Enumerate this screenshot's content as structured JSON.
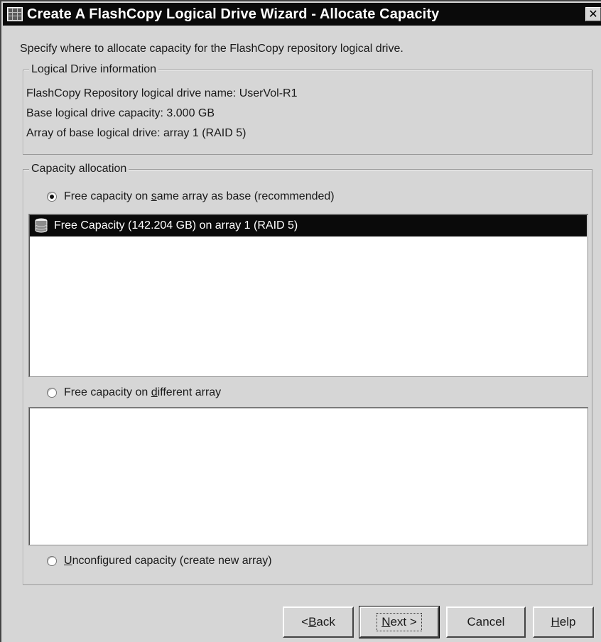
{
  "window": {
    "title": "Create A FlashCopy Logical Drive Wizard - Allocate Capacity",
    "close_glyph": "✕"
  },
  "instruction": "Specify where to allocate capacity for the FlashCopy repository logical drive.",
  "logical_drive_info": {
    "legend": "Logical Drive information",
    "repository_name_line": "FlashCopy Repository logical drive name: UserVol-R1",
    "base_capacity_line": "Base logical drive capacity: 3.000 GB",
    "array_line": "Array of base logical drive: array 1 (RAID 5)"
  },
  "capacity_allocation": {
    "legend": "Capacity allocation",
    "options": [
      {
        "pre": "Free capacity on ",
        "key": "s",
        "post": "ame array as base (recommended)",
        "checked": true
      },
      {
        "pre": "Free capacity on ",
        "key": "d",
        "post": "ifferent array",
        "checked": false
      },
      {
        "pre": "",
        "key": "U",
        "post": "nconfigured capacity (create new array)",
        "checked": false
      }
    ],
    "same_array_list": [
      {
        "label": "Free Capacity (142.204 GB) on array 1 (RAID 5)",
        "icon": "drive-icon",
        "selected": true
      }
    ],
    "different_array_list": []
  },
  "buttons": {
    "back": {
      "pre": "< ",
      "key": "B",
      "post": "ack"
    },
    "next": {
      "pre": "",
      "key": "N",
      "post": "ext >"
    },
    "cancel": "Cancel",
    "help": {
      "pre": "",
      "key": "H",
      "post": "elp"
    }
  },
  "colors": {
    "window_bg": "#d6d6d6",
    "titlebar_bg": "#0a0a0a",
    "selection_bg": "#0a0a0a",
    "list_bg": "#ffffff"
  }
}
